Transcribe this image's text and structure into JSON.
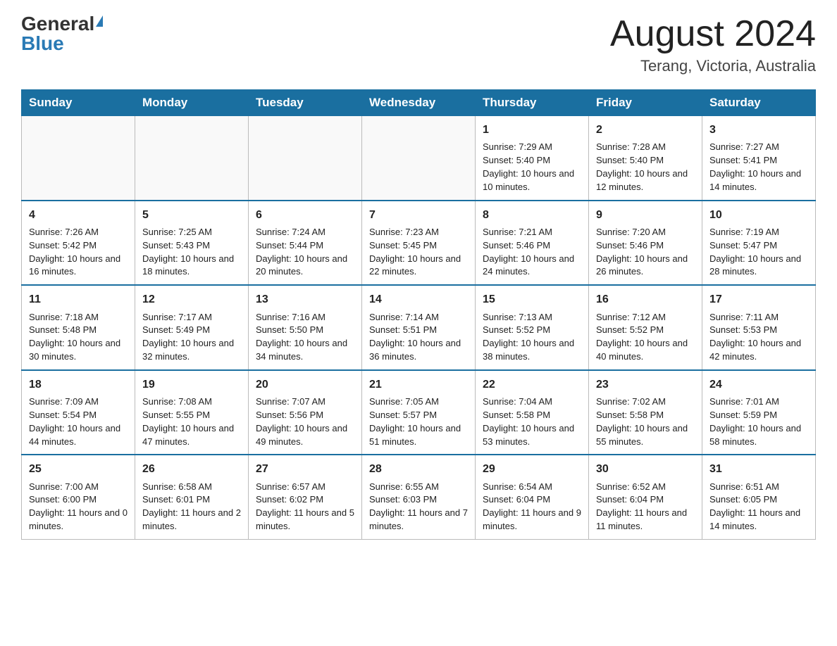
{
  "header": {
    "logo_general": "General",
    "logo_blue": "Blue",
    "month_title": "August 2024",
    "location": "Terang, Victoria, Australia"
  },
  "weekdays": [
    "Sunday",
    "Monday",
    "Tuesday",
    "Wednesday",
    "Thursday",
    "Friday",
    "Saturday"
  ],
  "weeks": [
    [
      {
        "day": "",
        "info": ""
      },
      {
        "day": "",
        "info": ""
      },
      {
        "day": "",
        "info": ""
      },
      {
        "day": "",
        "info": ""
      },
      {
        "day": "1",
        "info": "Sunrise: 7:29 AM\nSunset: 5:40 PM\nDaylight: 10 hours and 10 minutes."
      },
      {
        "day": "2",
        "info": "Sunrise: 7:28 AM\nSunset: 5:40 PM\nDaylight: 10 hours and 12 minutes."
      },
      {
        "day": "3",
        "info": "Sunrise: 7:27 AM\nSunset: 5:41 PM\nDaylight: 10 hours and 14 minutes."
      }
    ],
    [
      {
        "day": "4",
        "info": "Sunrise: 7:26 AM\nSunset: 5:42 PM\nDaylight: 10 hours and 16 minutes."
      },
      {
        "day": "5",
        "info": "Sunrise: 7:25 AM\nSunset: 5:43 PM\nDaylight: 10 hours and 18 minutes."
      },
      {
        "day": "6",
        "info": "Sunrise: 7:24 AM\nSunset: 5:44 PM\nDaylight: 10 hours and 20 minutes."
      },
      {
        "day": "7",
        "info": "Sunrise: 7:23 AM\nSunset: 5:45 PM\nDaylight: 10 hours and 22 minutes."
      },
      {
        "day": "8",
        "info": "Sunrise: 7:21 AM\nSunset: 5:46 PM\nDaylight: 10 hours and 24 minutes."
      },
      {
        "day": "9",
        "info": "Sunrise: 7:20 AM\nSunset: 5:46 PM\nDaylight: 10 hours and 26 minutes."
      },
      {
        "day": "10",
        "info": "Sunrise: 7:19 AM\nSunset: 5:47 PM\nDaylight: 10 hours and 28 minutes."
      }
    ],
    [
      {
        "day": "11",
        "info": "Sunrise: 7:18 AM\nSunset: 5:48 PM\nDaylight: 10 hours and 30 minutes."
      },
      {
        "day": "12",
        "info": "Sunrise: 7:17 AM\nSunset: 5:49 PM\nDaylight: 10 hours and 32 minutes."
      },
      {
        "day": "13",
        "info": "Sunrise: 7:16 AM\nSunset: 5:50 PM\nDaylight: 10 hours and 34 minutes."
      },
      {
        "day": "14",
        "info": "Sunrise: 7:14 AM\nSunset: 5:51 PM\nDaylight: 10 hours and 36 minutes."
      },
      {
        "day": "15",
        "info": "Sunrise: 7:13 AM\nSunset: 5:52 PM\nDaylight: 10 hours and 38 minutes."
      },
      {
        "day": "16",
        "info": "Sunrise: 7:12 AM\nSunset: 5:52 PM\nDaylight: 10 hours and 40 minutes."
      },
      {
        "day": "17",
        "info": "Sunrise: 7:11 AM\nSunset: 5:53 PM\nDaylight: 10 hours and 42 minutes."
      }
    ],
    [
      {
        "day": "18",
        "info": "Sunrise: 7:09 AM\nSunset: 5:54 PM\nDaylight: 10 hours and 44 minutes."
      },
      {
        "day": "19",
        "info": "Sunrise: 7:08 AM\nSunset: 5:55 PM\nDaylight: 10 hours and 47 minutes."
      },
      {
        "day": "20",
        "info": "Sunrise: 7:07 AM\nSunset: 5:56 PM\nDaylight: 10 hours and 49 minutes."
      },
      {
        "day": "21",
        "info": "Sunrise: 7:05 AM\nSunset: 5:57 PM\nDaylight: 10 hours and 51 minutes."
      },
      {
        "day": "22",
        "info": "Sunrise: 7:04 AM\nSunset: 5:58 PM\nDaylight: 10 hours and 53 minutes."
      },
      {
        "day": "23",
        "info": "Sunrise: 7:02 AM\nSunset: 5:58 PM\nDaylight: 10 hours and 55 minutes."
      },
      {
        "day": "24",
        "info": "Sunrise: 7:01 AM\nSunset: 5:59 PM\nDaylight: 10 hours and 58 minutes."
      }
    ],
    [
      {
        "day": "25",
        "info": "Sunrise: 7:00 AM\nSunset: 6:00 PM\nDaylight: 11 hours and 0 minutes."
      },
      {
        "day": "26",
        "info": "Sunrise: 6:58 AM\nSunset: 6:01 PM\nDaylight: 11 hours and 2 minutes."
      },
      {
        "day": "27",
        "info": "Sunrise: 6:57 AM\nSunset: 6:02 PM\nDaylight: 11 hours and 5 minutes."
      },
      {
        "day": "28",
        "info": "Sunrise: 6:55 AM\nSunset: 6:03 PM\nDaylight: 11 hours and 7 minutes."
      },
      {
        "day": "29",
        "info": "Sunrise: 6:54 AM\nSunset: 6:04 PM\nDaylight: 11 hours and 9 minutes."
      },
      {
        "day": "30",
        "info": "Sunrise: 6:52 AM\nSunset: 6:04 PM\nDaylight: 11 hours and 11 minutes."
      },
      {
        "day": "31",
        "info": "Sunrise: 6:51 AM\nSunset: 6:05 PM\nDaylight: 11 hours and 14 minutes."
      }
    ]
  ]
}
